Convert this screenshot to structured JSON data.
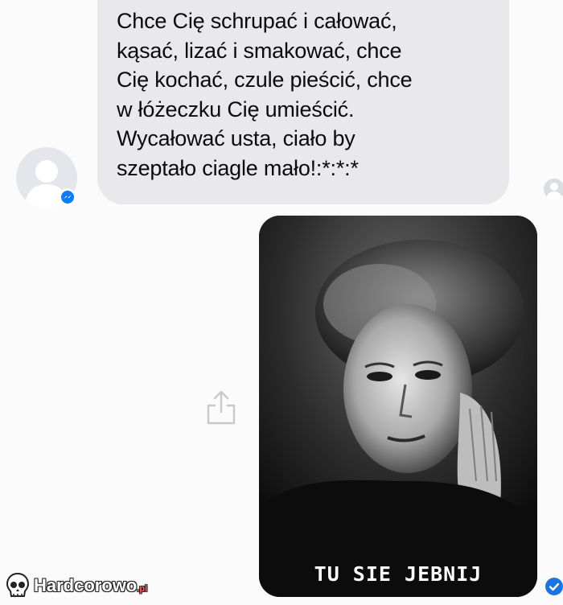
{
  "chat": {
    "incoming_message": "Chce Cię schrupać i całować,\nkąsać, lizać i smakować, chce\nCię kochać, czule pieścić, chce\nw łóżeczku Cię umieścić.\nWycałować usta, ciało by\nszeptało ciagle mało!:*:*:*",
    "sent_image_caption": "TU SIE JEBNIJ"
  },
  "icons": {
    "avatar": "default-profile-icon",
    "badge": "messenger-icon",
    "share": "share-icon",
    "seen": "seen-check-icon"
  },
  "watermark": {
    "brand": "Hardcorowo",
    "tld": ".pl"
  },
  "colors": {
    "bubble": "#e9e9ec",
    "messenger_blue": "#0a7cff",
    "seen_blue": "#1b74e4"
  }
}
